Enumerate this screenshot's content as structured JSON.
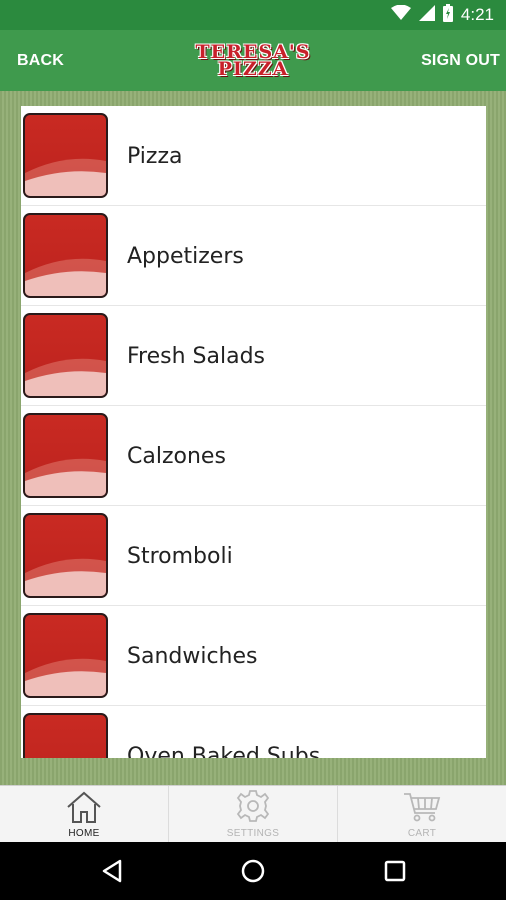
{
  "status_bar": {
    "time": "4:21"
  },
  "header": {
    "back_label": "BACK",
    "logo_line1": "TERESA'S",
    "logo_line2": "PIZZA",
    "sign_out_label": "SIGN OUT"
  },
  "menu": {
    "items": [
      {
        "label": "Pizza"
      },
      {
        "label": "Appetizers"
      },
      {
        "label": "Fresh Salads"
      },
      {
        "label": "Calzones"
      },
      {
        "label": "Stromboli"
      },
      {
        "label": "Sandwiches"
      },
      {
        "label": "Oven Baked Subs"
      }
    ]
  },
  "tabs": [
    {
      "label": "HOME",
      "icon": "home-icon",
      "active": true
    },
    {
      "label": "SETTINGS",
      "icon": "gear-icon",
      "active": false
    },
    {
      "label": "CART",
      "icon": "cart-icon",
      "active": false
    }
  ],
  "colors": {
    "header_green": "#3f9a4d",
    "status_green": "#2b8a3e",
    "thumb_red": "#c92a22",
    "logo_red": "#c8202a"
  }
}
